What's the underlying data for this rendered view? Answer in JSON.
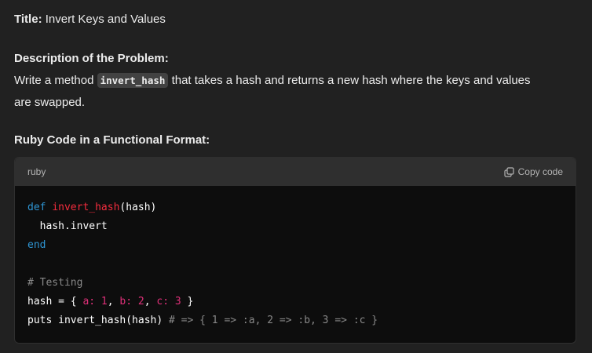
{
  "title": {
    "label": "Title:",
    "text": " Invert Keys and Values"
  },
  "description": {
    "heading": "Description of the Problem:",
    "pre": "Write a method ",
    "code": "invert_hash",
    "post": " that takes a hash and returns a new hash where the keys and values",
    "line2": "are swapped."
  },
  "code_heading": "Ruby Code in a Functional Format:",
  "code_block": {
    "language": "ruby",
    "copy_label": "Copy code",
    "icon": "copy-icon",
    "tokens": {
      "def": "def",
      "fname": "invert_hash",
      "params": "(hash)",
      "body": "  hash.invert",
      "end": "end",
      "comment1": "# Testing",
      "hash_pre": "hash = { ",
      "a": "a: 1",
      "sep1": ", ",
      "b": "b: 2",
      "sep2": ", ",
      "c": "c: 3",
      "hash_post": " }",
      "puts": "puts invert_hash(hash) ",
      "comment2": "# => { 1 => :a, 2 => :b, 3 => :c }"
    }
  }
}
